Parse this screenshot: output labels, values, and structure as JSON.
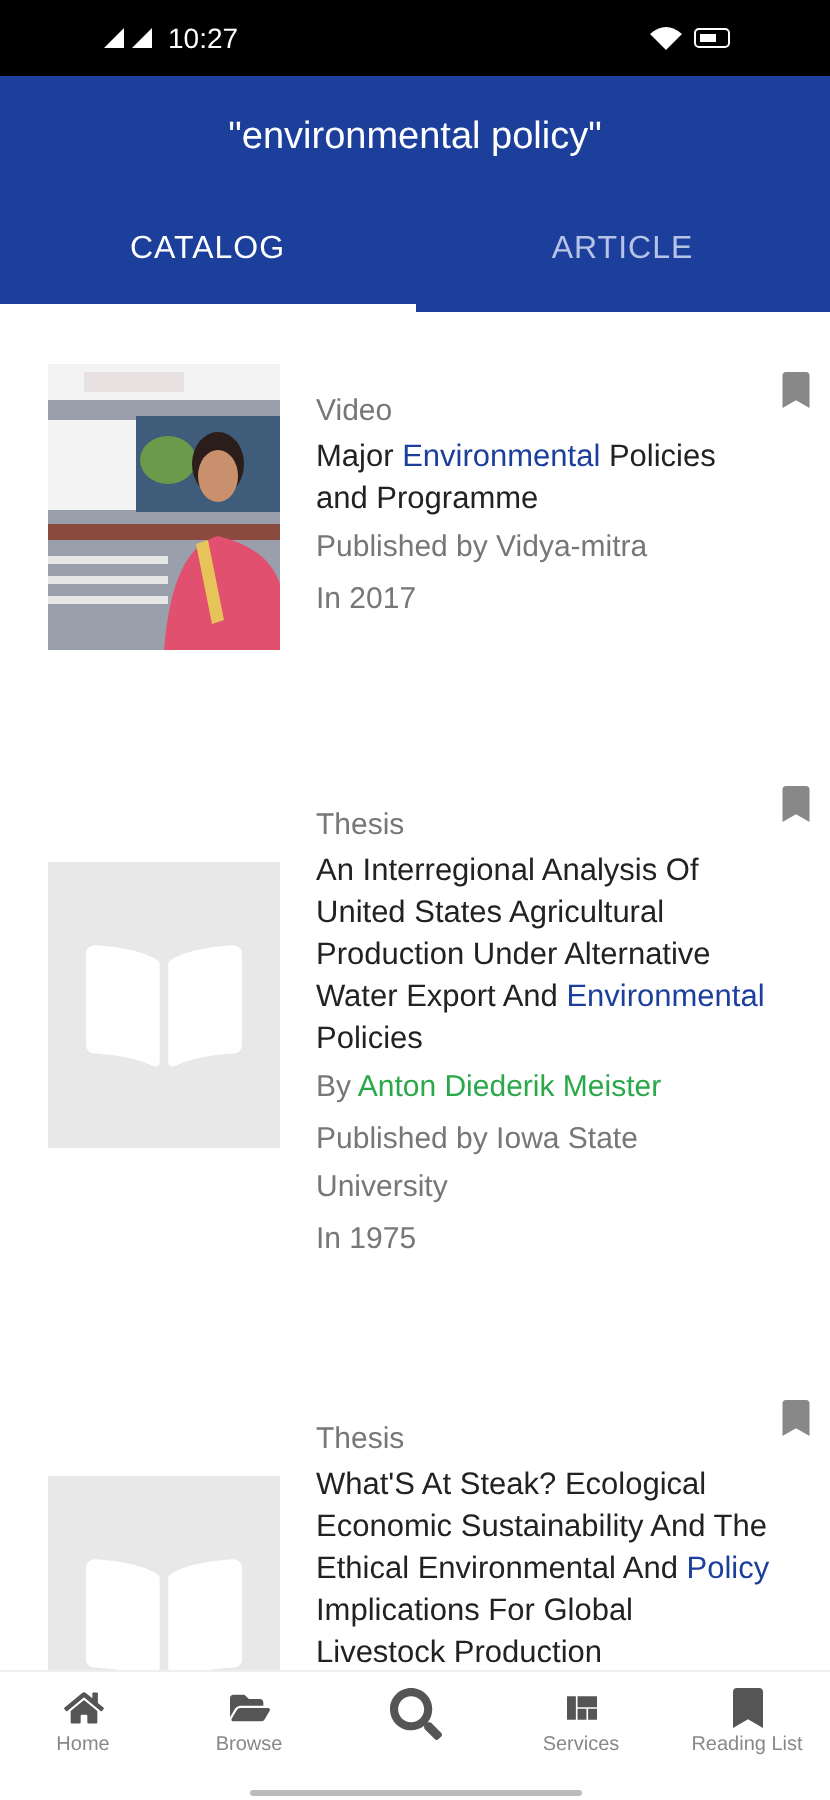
{
  "status_bar": {
    "time": "10:27"
  },
  "header": {
    "title": "\"environmental policy\""
  },
  "tabs": [
    {
      "label": "CATALOG",
      "selected": true
    },
    {
      "label": "ARTICLE",
      "selected": false
    }
  ],
  "results": [
    {
      "type": "Video",
      "kind": "picture",
      "title": [
        {
          "text": "Major ",
          "highlighted": false
        },
        {
          "text": "Environmental",
          "highlighted": true
        },
        {
          "text": " Policies and Programme",
          "highlighted": false
        }
      ],
      "publisher": "Published by Vidya-mitra",
      "year": "In 2017"
    },
    {
      "type": "Thesis",
      "kind": "book",
      "title": [
        {
          "text": "An Interregional Analysis Of United States Agricultural Production Under Alternative Water Export And ",
          "highlighted": false
        },
        {
          "text": "Environmental",
          "highlighted": true
        },
        {
          "text": " Policies",
          "highlighted": false
        }
      ],
      "author_prefix": "By ",
      "author": "Anton Diederik Meister",
      "publisher": "Published by Iowa State University",
      "year": "In 1975"
    },
    {
      "type": "Thesis",
      "kind": "book",
      "title": [
        {
          "text": "What'S At Steak? Ecological Economic Sustainability And The Ethical Environmental And ",
          "highlighted": false
        },
        {
          "text": "Policy",
          "highlighted": true
        },
        {
          "text": " Implications For Global Livestock Production",
          "highlighted": false
        }
      ]
    }
  ],
  "nav": [
    {
      "kind": "home",
      "label": "Home"
    },
    {
      "kind": "browse",
      "label": "Browse"
    },
    {
      "kind": "search"
    },
    {
      "kind": "services",
      "label": "Services"
    },
    {
      "kind": "reading",
      "label": "Reading List"
    }
  ]
}
